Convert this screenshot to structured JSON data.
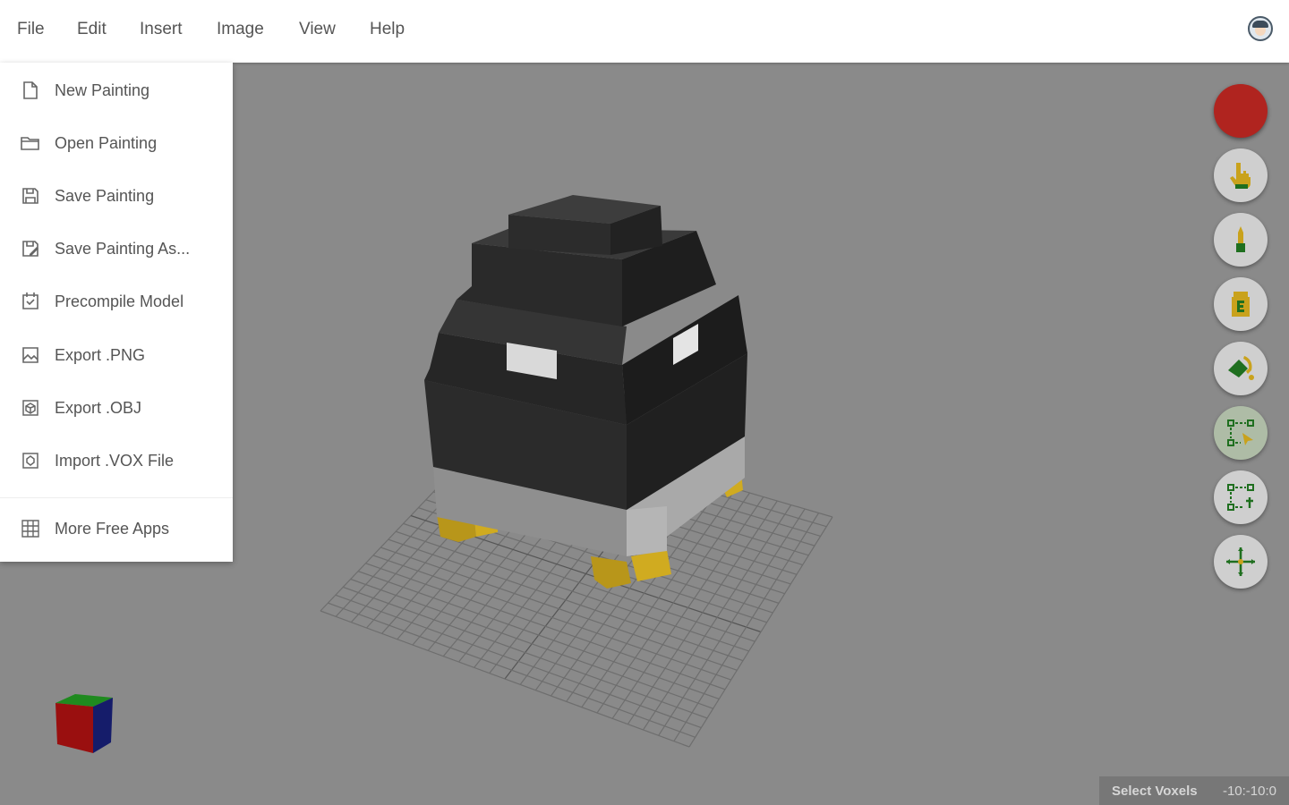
{
  "menubar": {
    "file": "File",
    "edit": "Edit",
    "insert": "Insert",
    "image": "Image",
    "view": "View",
    "help": "Help"
  },
  "file_menu": {
    "items": [
      {
        "label": "New Painting",
        "icon": "new-file-icon"
      },
      {
        "label": "Open Painting",
        "icon": "folder-open-icon"
      },
      {
        "label": "Save Painting",
        "icon": "save-icon"
      },
      {
        "label": "Save Painting As...",
        "icon": "save-as-icon"
      },
      {
        "label": "Precompile Model",
        "icon": "precompile-icon"
      },
      {
        "label": "Export .PNG",
        "icon": "image-export-icon"
      },
      {
        "label": "Export .OBJ",
        "icon": "object-export-icon"
      },
      {
        "label": "Import .VOX File",
        "icon": "import-icon"
      }
    ],
    "more": {
      "label": "More Free Apps",
      "icon": "apps-grid-icon"
    }
  },
  "toolbar": {
    "current_color": "#b0241f",
    "tools": [
      "color-picker-button",
      "pointer-tool",
      "brush-tool",
      "eraser-tool",
      "paint-bucket-tool",
      "select-voxels-tool",
      "deselect-tool",
      "move-tool"
    ],
    "active_tool": "select-voxels-tool"
  },
  "status": {
    "mode": "Select Voxels",
    "coords": "-10:-10:0"
  },
  "colors": {
    "viewport_bg": "#8a8a8a",
    "icon_green": "#1f6f1f",
    "icon_yellow": "#c9a21c"
  }
}
